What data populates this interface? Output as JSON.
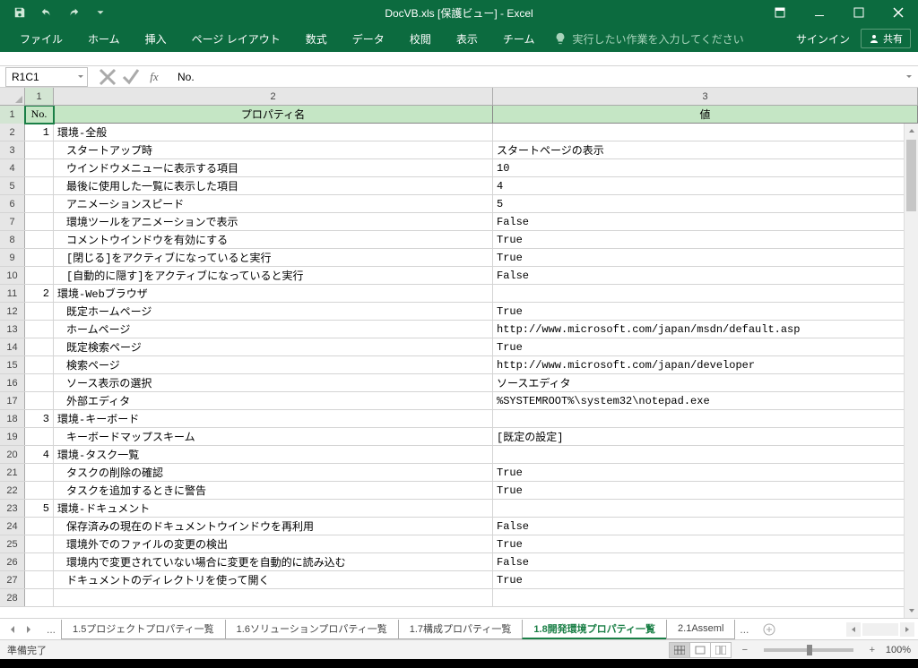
{
  "app": {
    "title": "DocVB.xls [保護ビュー] - Excel"
  },
  "ribbon": {
    "tabs": [
      "ファイル",
      "ホーム",
      "挿入",
      "ページ レイアウト",
      "数式",
      "データ",
      "校閲",
      "表示",
      "チーム"
    ],
    "tell_me": "実行したい作業を入力してください",
    "sign_in": "サインイン",
    "share": "共有"
  },
  "formula_bar": {
    "name_box": "R1C1",
    "formula": "No."
  },
  "columns": [
    "1",
    "2",
    "3"
  ],
  "headers": {
    "no": "No.",
    "prop": "プロパティ名",
    "val": "値"
  },
  "rows": [
    {
      "n": "1",
      "no": "1",
      "prop": "環境-全般",
      "val": "",
      "indent": false
    },
    {
      "n": "2",
      "no": "",
      "prop": "スタートアップ時",
      "val": "スタートページの表示",
      "indent": true
    },
    {
      "n": "3",
      "no": "",
      "prop": "ウインドウメニューに表示する項目",
      "val": "10",
      "indent": true
    },
    {
      "n": "4",
      "no": "",
      "prop": "最後に使用した一覧に表示した項目",
      "val": "4",
      "indent": true
    },
    {
      "n": "5",
      "no": "",
      "prop": "アニメーションスピード",
      "val": "5",
      "indent": true
    },
    {
      "n": "6",
      "no": "",
      "prop": "環境ツールをアニメーションで表示",
      "val": "False",
      "indent": true
    },
    {
      "n": "7",
      "no": "",
      "prop": "コメントウインドウを有効にする",
      "val": "True",
      "indent": true
    },
    {
      "n": "8",
      "no": "",
      "prop": "[閉じる]をアクティブになっていると実行",
      "val": "True",
      "indent": true
    },
    {
      "n": "9",
      "no": "",
      "prop": "[自動的に隠す]をアクティブになっていると実行",
      "val": "False",
      "indent": true
    },
    {
      "n": "10",
      "no": "2",
      "prop": "環境-Webブラウザ",
      "val": "",
      "indent": false
    },
    {
      "n": "11",
      "no": "",
      "prop": "既定ホームページ",
      "val": "True",
      "indent": true
    },
    {
      "n": "12",
      "no": "",
      "prop": "ホームページ",
      "val": "http://www.microsoft.com/japan/msdn/default.asp",
      "indent": true
    },
    {
      "n": "13",
      "no": "",
      "prop": "既定検索ページ",
      "val": "True",
      "indent": true
    },
    {
      "n": "14",
      "no": "",
      "prop": "検索ページ",
      "val": "http://www.microsoft.com/japan/developer",
      "indent": true
    },
    {
      "n": "15",
      "no": "",
      "prop": "ソース表示の選択",
      "val": "ソースエディタ",
      "indent": true
    },
    {
      "n": "16",
      "no": "",
      "prop": "外部エディタ",
      "val": "%SYSTEMROOT%\\system32\\notepad.exe",
      "indent": true
    },
    {
      "n": "17",
      "no": "3",
      "prop": "環境-キーボード",
      "val": "",
      "indent": false
    },
    {
      "n": "18",
      "no": "",
      "prop": "キーボードマップスキーム",
      "val": "[既定の設定]",
      "indent": true
    },
    {
      "n": "19",
      "no": "4",
      "prop": "環境-タスク一覧",
      "val": "",
      "indent": false
    },
    {
      "n": "20",
      "no": "",
      "prop": "タスクの削除の確認",
      "val": "True",
      "indent": true
    },
    {
      "n": "21",
      "no": "",
      "prop": "タスクを追加するときに警告",
      "val": "True",
      "indent": true
    },
    {
      "n": "22",
      "no": "5",
      "prop": "環境-ドキュメント",
      "val": "",
      "indent": false
    },
    {
      "n": "23",
      "no": "",
      "prop": "保存済みの現在のドキュメントウインドウを再利用",
      "val": "False",
      "indent": true
    },
    {
      "n": "24",
      "no": "",
      "prop": "環境外でのファイルの変更の検出",
      "val": "True",
      "indent": true
    },
    {
      "n": "25",
      "no": "",
      "prop": "環境内で変更されていない場合に変更を自動的に読み込む",
      "val": "False",
      "indent": true
    },
    {
      "n": "26",
      "no": "",
      "prop": "ドキュメントのディレクトリを使って開く",
      "val": "True",
      "indent": true
    }
  ],
  "sheet_tabs": {
    "hidden_left": "...",
    "tabs": [
      "1.5プロジェクトプロパティ一覧",
      "1.6ソリューションプロパティ一覧",
      "1.7構成プロパティ一覧",
      "1.8開発環境プロパティ一覧",
      "2.1Asseml"
    ],
    "active": 3,
    "hidden_right": "..."
  },
  "status": {
    "ready": "準備完了",
    "zoom": "100%"
  }
}
